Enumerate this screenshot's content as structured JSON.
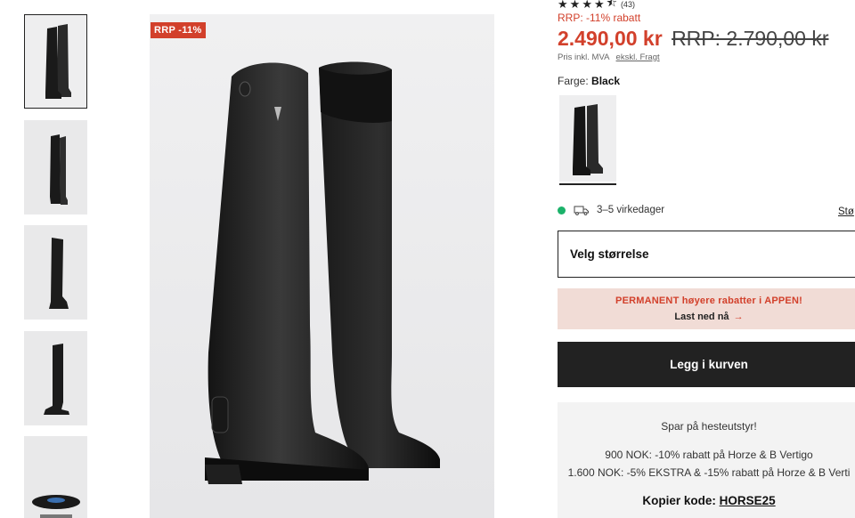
{
  "gallery": {
    "thumbnails": [
      {
        "label": "boot-pair-front",
        "active": true
      },
      {
        "label": "boot-pair-back",
        "active": false
      },
      {
        "label": "boot-side-outer",
        "active": false
      },
      {
        "label": "boot-side-inner",
        "active": false
      },
      {
        "label": "boot-sole",
        "active": false
      }
    ]
  },
  "badge": {
    "text": "RRP -11%"
  },
  "product": {
    "rating_count": "(43)",
    "rating": 4.5,
    "discount_text": "RRP: -11% rabatt",
    "price": "2.490,00 kr",
    "old_price": "RRP: 2.790,00 kr",
    "price_note": "Pris inkl. MVA",
    "freight_link": "ekskl. Fragt",
    "color_label": "Farge:",
    "color_value": "Black",
    "delivery_text": "3–5 virkedager",
    "size_guide": "Stø",
    "size_select": "Velg størrelse"
  },
  "promo": {
    "line1": "PERMANENT høyere rabatter i APPEN!",
    "line2": "Last ned nå",
    "arrow": "→"
  },
  "cart": {
    "label": "Legg i kurven"
  },
  "offer": {
    "title": "Spar på hesteutstyr!",
    "line_a": "900 NOK: -10% rabatt på Horze & B Vertigo",
    "line_b": "1.600 NOK: -5% EKSTRA & -15% rabatt på Horze & B Verti",
    "code_label": "Kopier kode:",
    "code": "HORSE25"
  },
  "colors": {
    "sale_red": "#d2402b",
    "dark": "#222222",
    "promo_bg": "#f1dcd6",
    "stock_green": "#1bb26a"
  }
}
